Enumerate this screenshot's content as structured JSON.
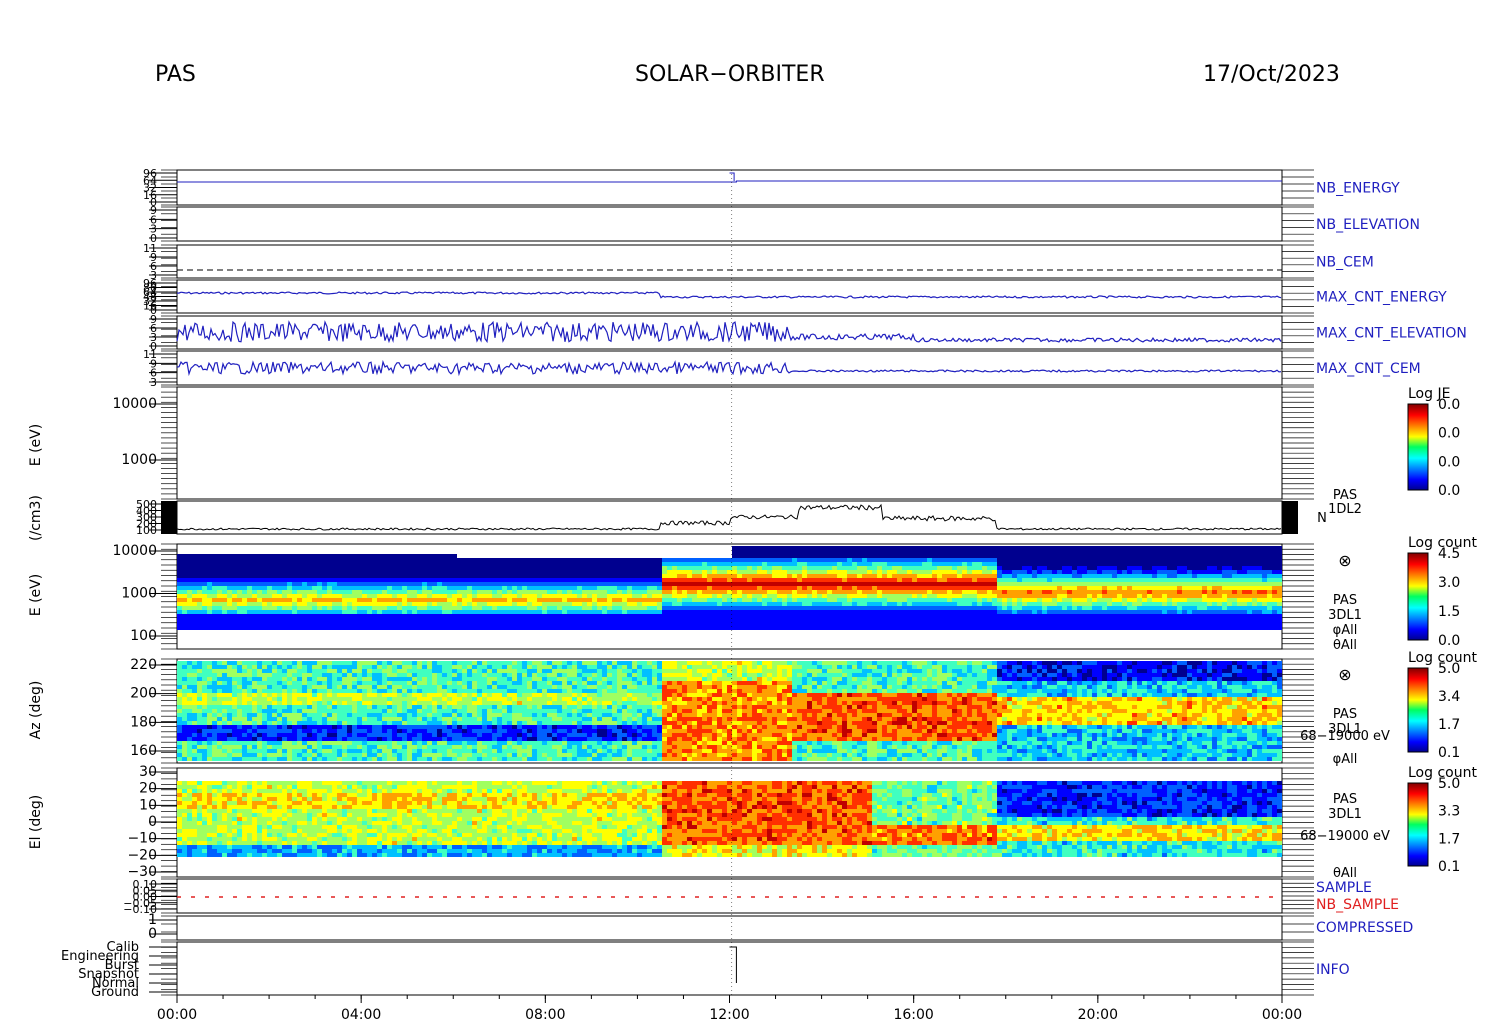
{
  "header": {
    "left": "PAS",
    "center": "SOLAR−ORBITER",
    "right": "17/Oct/2023"
  },
  "colors": {
    "housekeeping_trace": "#1f1fbf",
    "nb_sample": "#e02020",
    "sample": "#1f1fbf"
  },
  "chart_data": [
    {
      "type": "line",
      "panels": [
        {
          "right_label": "NB_ENERGY",
          "ticks": [
            "96",
            "64",
            "32",
            "16",
            "0"
          ]
        },
        {
          "right_label": "NB_ELEVATION",
          "ticks": [
            "9",
            "6",
            "3",
            "0"
          ]
        },
        {
          "right_label": "NB_CEM",
          "ticks": [
            "11",
            "9",
            "6",
            "3"
          ]
        },
        {
          "right_label": "MAX_CNT_ENERGY",
          "ticks": [
            "96",
            "80",
            "64",
            "48",
            "32",
            "16",
            "0"
          ]
        },
        {
          "right_label": "MAX_CNT_ELEVATION",
          "ticks": [
            "9",
            "6",
            "3",
            "0"
          ]
        },
        {
          "right_label": "MAX_CNT_CEM",
          "ticks": [
            "11",
            "9",
            "6",
            "3"
          ]
        }
      ]
    },
    {
      "type": "heatmap",
      "ylabel": "E (eV)",
      "yticks": [
        "10000",
        "1000"
      ],
      "colorbar": {
        "title": "Log JE",
        "ticks": [
          "0.0",
          "0.0",
          "0.0",
          "0.0"
        ]
      }
    },
    {
      "type": "line",
      "ylabel": "(/cm3)",
      "yticks": [
        "500",
        "400",
        "300",
        "200",
        "100"
      ],
      "right_labels": [
        "PAS",
        "1DL2",
        "N"
      ]
    },
    {
      "type": "heatmap",
      "ylabel": "E (eV)",
      "yticks": [
        "10000",
        "1000",
        "100"
      ],
      "colorbar": {
        "title": "Log count",
        "ticks": [
          "4.5",
          "3.0",
          "1.5",
          "0.0"
        ]
      },
      "right_labels": [
        "PAS",
        "3DL1",
        "φAll",
        "θAll"
      ]
    },
    {
      "type": "heatmap",
      "ylabel": "Az (deg)",
      "yticks": [
        "220",
        "200",
        "180",
        "160"
      ],
      "colorbar": {
        "title": "Log count",
        "ticks": [
          "5.0",
          "3.4",
          "1.7",
          "0.1"
        ]
      },
      "right_labels": [
        "PAS",
        "3DL1",
        "68−19000 eV",
        "φAll"
      ]
    },
    {
      "type": "heatmap",
      "ylabel": "El (deg)",
      "yticks": [
        "30",
        "20",
        "10",
        "0",
        "−10",
        "−20",
        "−30"
      ],
      "colorbar": {
        "title": "Log count",
        "ticks": [
          "5.0",
          "3.3",
          "1.7",
          "0.1"
        ]
      },
      "right_labels": [
        "PAS",
        "3DL1",
        "68−19000 eV",
        "θAll"
      ]
    },
    {
      "type": "line",
      "yticks": [
        "0.10",
        "0.05",
        "0.00",
        "−0.05",
        "−0.10"
      ],
      "right_labels": [
        "SAMPLE",
        "NB_SAMPLE"
      ]
    },
    {
      "type": "line",
      "yticks": [
        "1",
        "0"
      ],
      "right_labels": [
        "COMPRESSED"
      ]
    },
    {
      "type": "line",
      "yticks": [
        "Calib",
        "Engineering",
        "Burst",
        "Snapshot",
        "Normal",
        "Ground"
      ],
      "right_labels": [
        "INFO"
      ]
    }
  ],
  "xaxis": {
    "ticks": [
      "00:00",
      "04:00",
      "08:00",
      "12:00",
      "16:00",
      "20:00",
      "00:00"
    ]
  }
}
